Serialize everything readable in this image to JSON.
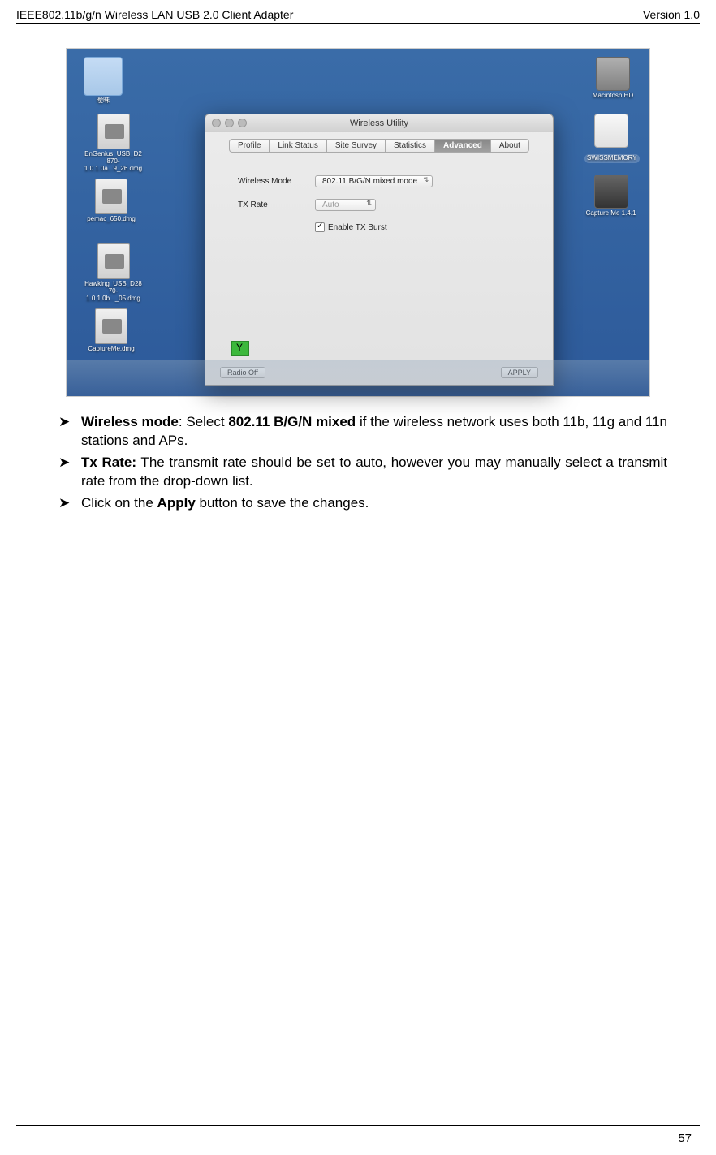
{
  "header": {
    "left": "IEEE802.11b/g/n Wireless LAN USB 2.0 Client Adapter",
    "right": "Version 1.0"
  },
  "desktop": {
    "folder_label": "曖昧",
    "dmg1": "EnGenius_USB_D2870-1.0.1.0a...9_26.dmg",
    "dmg2": "pemac_650.dmg",
    "dmg3": "Hawking_USB_D2870-1.0.1.0b..._05.dmg",
    "dmg4": "CaptureMe.dmg",
    "hd": "Macintosh HD",
    "usb": "SWISSMEMORY",
    "capture": "Capture Me 1.4.1"
  },
  "window": {
    "title": "Wireless Utility",
    "tabs": {
      "profile": "Profile",
      "link_status": "Link Status",
      "site_survey": "Site Survey",
      "statistics": "Statistics",
      "advanced": "Advanced",
      "about": "About"
    },
    "wireless_mode_label": "Wireless Mode",
    "wireless_mode_value": "802.11 B/G/N mixed mode",
    "tx_rate_label": "TX Rate",
    "tx_rate_value": "Auto",
    "enable_tx_burst": "Enable TX Burst",
    "radio_off": "Radio Off",
    "apply": "APPLY"
  },
  "bullets": {
    "b1_prefix": " Wireless mode",
    "b1_mid": ": Select ",
    "b1_bold": "802.11 B/G/N mixed",
    "b1_rest": " if the wireless network uses both 11b, 11g and 11n stations and APs.",
    "b2_prefix": "Tx Rate:",
    "b2_rest": " The transmit rate should be set to auto, however you may manually select a transmit rate from the drop-down list.",
    "b3_pre": "Click on the ",
    "b3_bold": "Apply",
    "b3_post": " button to save the changes."
  },
  "page_number": "57"
}
